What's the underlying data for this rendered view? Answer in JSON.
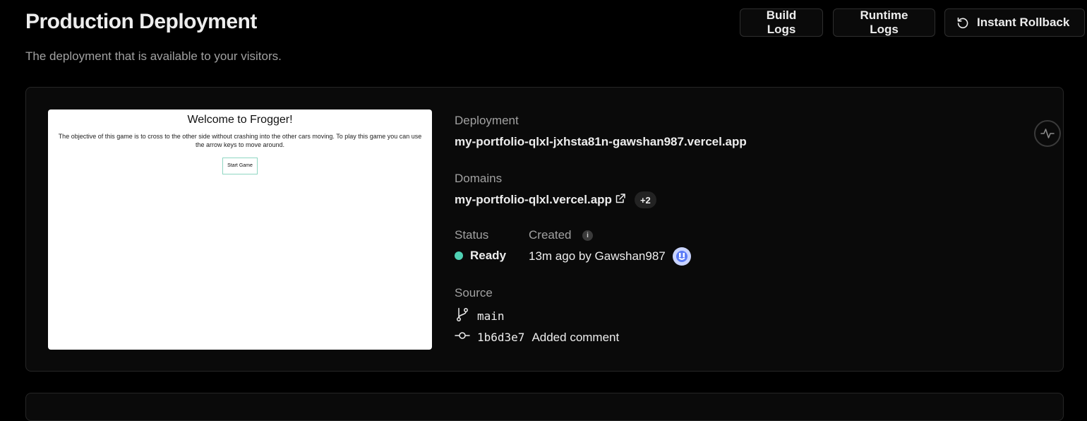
{
  "header": {
    "title": "Production Deployment",
    "subtitle": "The deployment that is available to your visitors.",
    "buttons": {
      "build_logs": "Build Logs",
      "runtime_logs": "Runtime Logs",
      "instant_rollback": "Instant Rollback"
    }
  },
  "preview": {
    "title": "Welcome to Frogger!",
    "text": "The objective of this game is to cross to the other side without crashing into the other cars moving. To play this game you can use the arrow keys to move around.",
    "start_button": "Start Game"
  },
  "deployment": {
    "label": "Deployment",
    "url": "my-portfolio-qlxl-jxhsta81n-gawshan987.vercel.app"
  },
  "domains": {
    "label": "Domains",
    "primary": "my-portfolio-qlxl.vercel.app",
    "extra_count": "+2"
  },
  "status": {
    "label": "Status",
    "value": "Ready",
    "color": "#4fd1b4"
  },
  "created": {
    "label": "Created",
    "value": "13m ago by Gawshan987",
    "info_icon": "i"
  },
  "source": {
    "label": "Source",
    "branch": "main",
    "commit_hash": "1b6d3e7",
    "commit_message": "Added comment"
  },
  "colors": {
    "background": "#000000",
    "card": "#0a0a0a",
    "border": "#262626",
    "muted_text": "#a1a1a1",
    "text": "#ededed"
  }
}
